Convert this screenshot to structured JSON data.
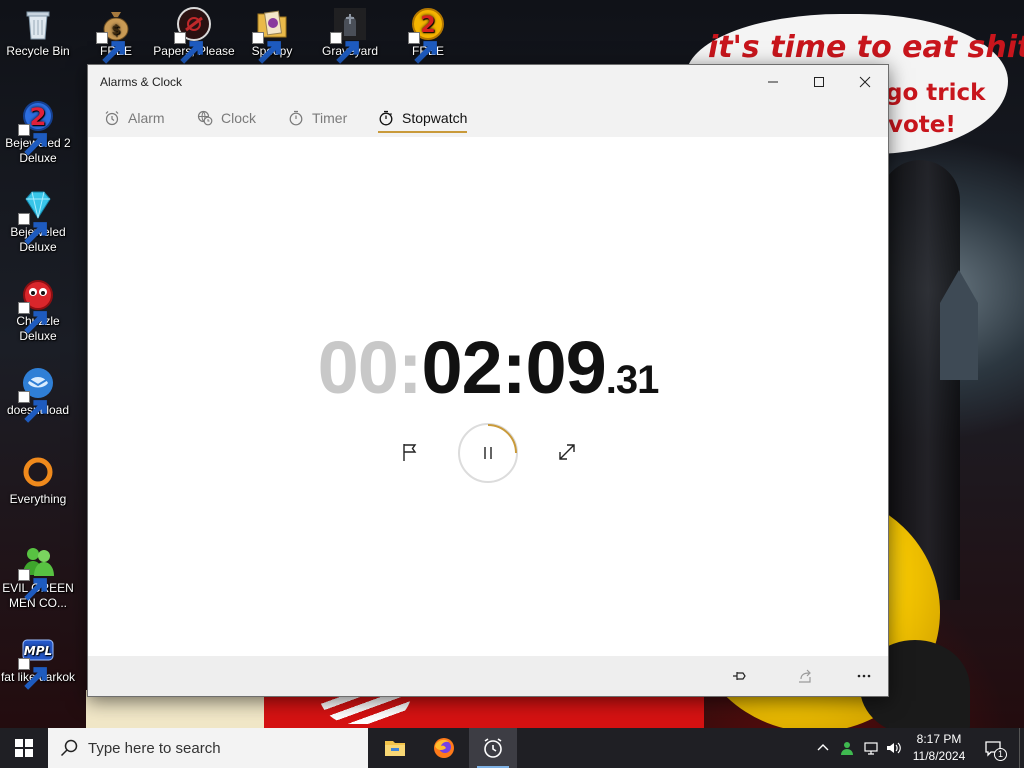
{
  "wallpaper": {
    "bubble_line1": "it's time to eat shit",
    "bubble_line2": "go trick",
    "bubble_line3": "vote!"
  },
  "desktop_icons": [
    {
      "label": "Recycle Bin",
      "icon": "recycle-bin-icon"
    },
    {
      "label": "FREE",
      "icon": "money-bag-icon"
    },
    {
      "label": "Papers, Please",
      "icon": "papers-please-icon"
    },
    {
      "label": "Spoopy",
      "icon": "spoopy-icon"
    },
    {
      "label": "Graveyard",
      "icon": "graveyard-icon"
    },
    {
      "label": "FREE",
      "icon": "gold-two-icon"
    },
    {
      "label": "Bejeweled 2 Deluxe",
      "icon": "bejeweled-2-icon"
    },
    {
      "label": "Bejeweled Deluxe",
      "icon": "bejeweled-icon"
    },
    {
      "label": "Chuzzle Deluxe",
      "icon": "chuzzle-icon"
    },
    {
      "label": "doesnt load",
      "icon": "thunderbird-icon"
    },
    {
      "label": "Everything",
      "icon": "everything-search-icon"
    },
    {
      "label": "EVIL GREEN MEN CO...",
      "icon": "green-men-icon"
    },
    {
      "label": "fat like darkok",
      "icon": "mpl-icon"
    }
  ],
  "window": {
    "title": "Alarms & Clock",
    "tabs": [
      {
        "label": "Alarm",
        "icon": "alarm-icon",
        "active": false
      },
      {
        "label": "Clock",
        "icon": "world-clock-icon",
        "active": false
      },
      {
        "label": "Timer",
        "icon": "timer-icon",
        "active": false
      },
      {
        "label": "Stopwatch",
        "icon": "stopwatch-icon",
        "active": true
      }
    ],
    "stopwatch": {
      "hours": "00:",
      "minutes_seconds": "02:09",
      "centiseconds": ".31"
    },
    "controls": [
      "flag-icon",
      "pause-icon",
      "expand-icon"
    ],
    "commands": [
      "pin-icon",
      "share-icon",
      "more-icon"
    ]
  },
  "taskbar": {
    "search_placeholder": "Type here to search",
    "time": "8:17 PM",
    "date": "11/8/2024",
    "notification_count": "1",
    "apps": [
      "file-explorer-icon",
      "firefox-icon",
      "alarms-clock-icon"
    ]
  },
  "colors": {
    "accent": "#c99a3a",
    "taskbar": "#1f1f24",
    "hours_grey": "#c8c8c8"
  }
}
